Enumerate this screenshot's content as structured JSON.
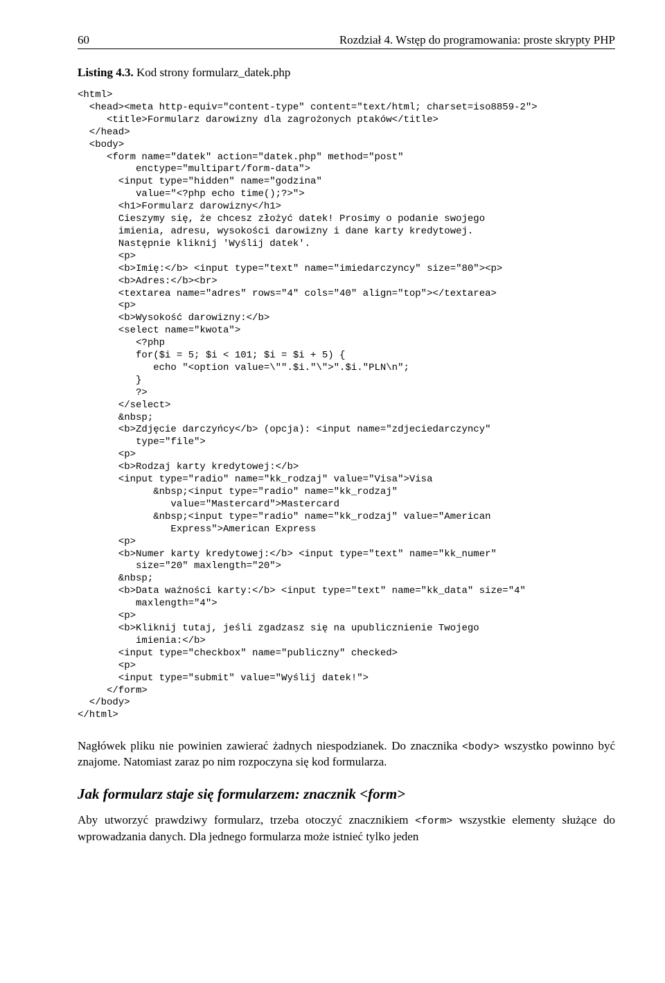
{
  "header": {
    "page_number": "60",
    "chapter": "Rozdział 4. Wstęp do programowania: proste skrypty PHP"
  },
  "listing": {
    "label": "Listing 4.3.",
    "caption": "Kod strony formularz_datek.php",
    "code": "<html>\n  <head><meta http-equiv=\"content-type\" content=\"text/html; charset=iso8859-2\">\n     <title>Formularz darowizny dla zagrożonych ptaków</title>\n  </head>\n  <body>\n     <form name=\"datek\" action=\"datek.php\" method=\"post\"\n          enctype=\"multipart/form-data\">\n       <input type=\"hidden\" name=\"godzina\"\n          value=\"<?php echo time();?>\">\n       <h1>Formularz darowizny</h1>\n       Cieszymy się, że chcesz złożyć datek! Prosimy o podanie swojego\n       imienia, adresu, wysokości darowizny i dane karty kredytowej.\n       Następnie kliknij 'Wyślij datek'.\n       <p>\n       <b>Imię:</b> <input type=\"text\" name=\"imiedarczyncy\" size=\"80\"><p>\n       <b>Adres:</b><br>\n       <textarea name=\"adres\" rows=\"4\" cols=\"40\" align=\"top\"></textarea>\n       <p>\n       <b>Wysokość darowizny:</b>\n       <select name=\"kwota\">\n          <?php\n          for($i = 5; $i < 101; $i = $i + 5) {\n             echo \"<option value=\\\"\".$i.\"\\\">\".$i.\"PLN\\n\";\n          }\n          ?>\n       </select>\n       &nbsp;\n       <b>Zdjęcie darczyńcy</b> (opcja): <input name=\"zdjeciedarczyncy\"\n          type=\"file\">\n       <p>\n       <b>Rodzaj karty kredytowej:</b>\n       <input type=\"radio\" name=\"kk_rodzaj\" value=\"Visa\">Visa\n             &nbsp;<input type=\"radio\" name=\"kk_rodzaj\"\n                value=\"Mastercard\">Mastercard\n             &nbsp;<input type=\"radio\" name=\"kk_rodzaj\" value=\"American\n                Express\">American Express\n       <p>\n       <b>Numer karty kredytowej:</b> <input type=\"text\" name=\"kk_numer\"\n          size=\"20\" maxlength=\"20\">\n       &nbsp;\n       <b>Data ważności karty:</b> <input type=\"text\" name=\"kk_data\" size=\"4\"\n          maxlength=\"4\">\n       <p>\n       <b>Kliknij tutaj, jeśli zgadzasz się na upublicznienie Twojego\n          imienia:</b>\n       <input type=\"checkbox\" name=\"publiczny\" checked>\n       <p>\n       <input type=\"submit\" value=\"Wyślij datek!\">\n     </form>\n  </body>\n</html>"
  },
  "paragraphs": {
    "p1_a": "Nagłówek pliku nie powinien zawierać żadnych niespodzianek. Do znacznika ",
    "p1_code": "<body>",
    "p1_b": " wszystko powinno być znajome. Natomiast zaraz po nim rozpoczyna się kod formularza."
  },
  "subhead": "Jak formularz staje się formularzem: znacznik <form>",
  "paragraphs2": {
    "p2_a": "Aby utworzyć prawdziwy formularz, trzeba otoczyć znacznikiem ",
    "p2_code": "<form>",
    "p2_b": " wszystkie elementy służące do wprowadzania danych. Dla jednego formularza może istnieć tylko jeden"
  }
}
